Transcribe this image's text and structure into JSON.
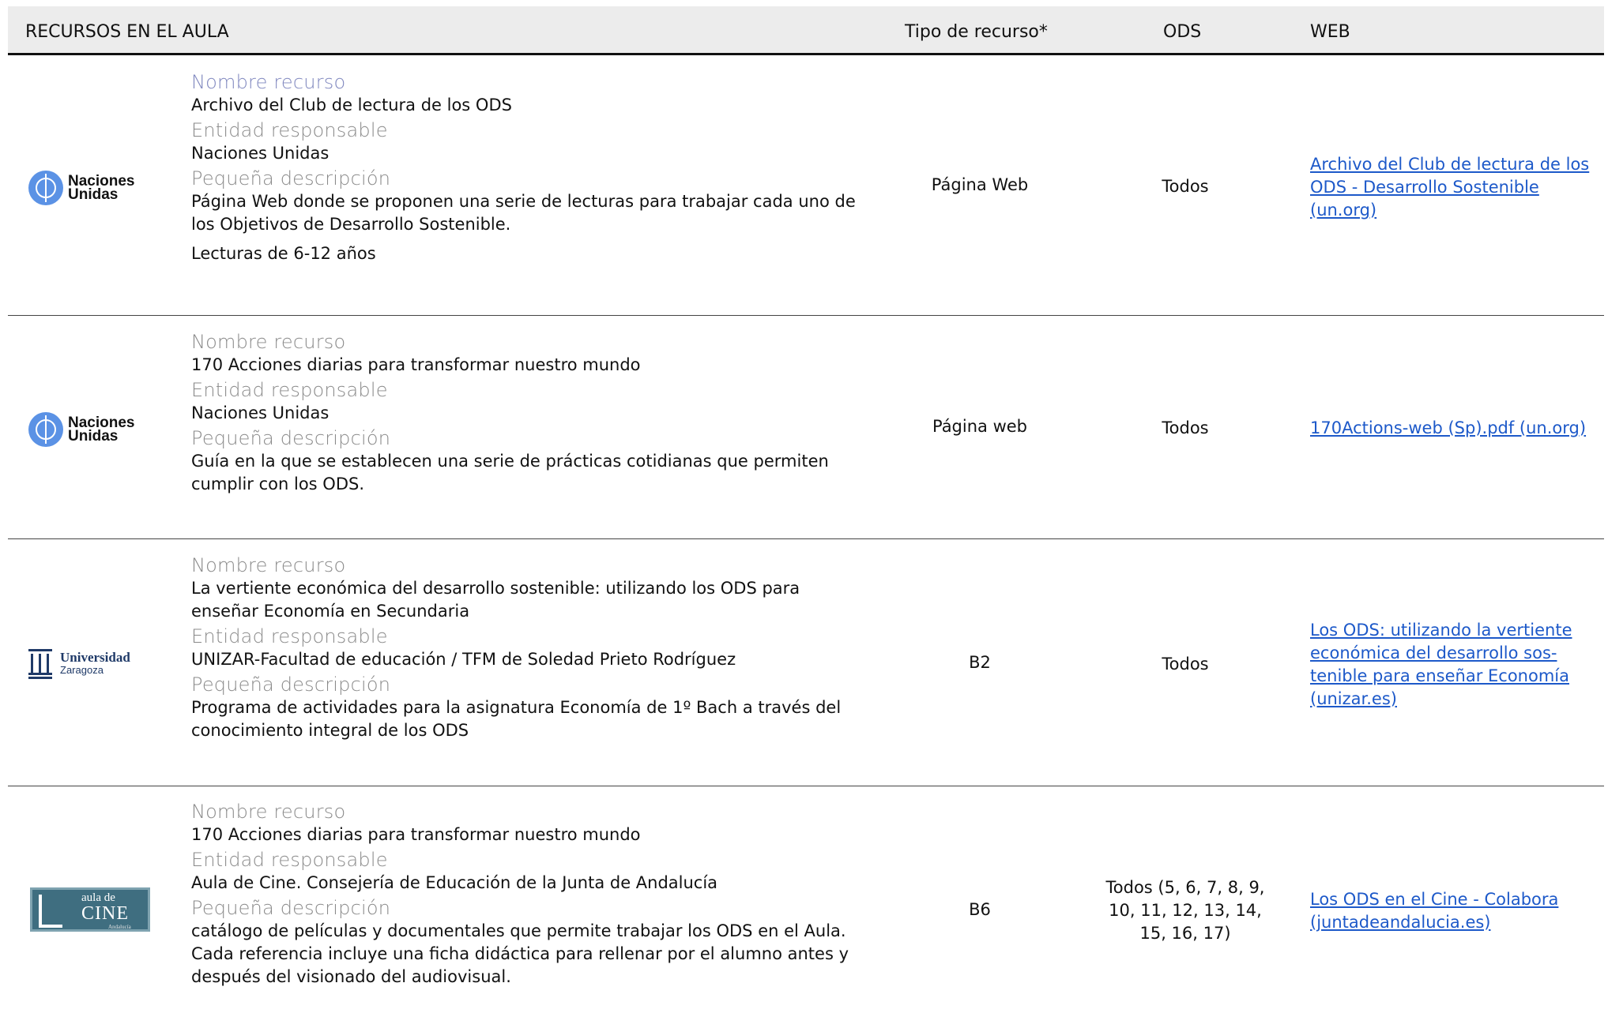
{
  "header": {
    "recursos": "RECURSOS EN EL AULA",
    "tipo": "Tipo de recurso*",
    "ods": "ODS",
    "web": "WEB"
  },
  "labels": {
    "nombre": "Nombre recurso",
    "entidad": "Entidad responsable",
    "descripcion": "Pequeña descripción"
  },
  "rows": [
    {
      "logo": "naciones-unidas",
      "logo_text": [
        "Naciones",
        "Unidas"
      ],
      "nombre": "Archivo del Club de lectura de los ODS",
      "entidad": "Naciones Unidas",
      "descripcion": "Página Web donde se proponen una serie de lecturas para trabajar cada uno de los Objetivos de Desarrollo Sostenible.",
      "extra": "Lecturas de 6-12 años",
      "tipo": "Página Web",
      "ods": "Todos",
      "web": "Archivo del Club de lectura de los ODS - Desarrollo Sostenible (un.org)"
    },
    {
      "logo": "naciones-unidas",
      "logo_text": [
        "Naciones",
        "Unidas"
      ],
      "nombre": "170 Acciones diarias para transformar nuestro mundo",
      "entidad": "Naciones Unidas",
      "descripcion": "Guía en la que se establecen una serie de prácticas cotidianas que permiten cumplir con los ODS.",
      "tipo": "Página web",
      "ods": "Todos",
      "web": "170Actions-web (Sp).pdf (un.org)"
    },
    {
      "logo": "universidad-zaragoza",
      "logo_text": [
        "Universidad",
        "Zaragoza"
      ],
      "nombre": "La vertiente económica del desarrollo sostenible: utilizando los ODS para enseñar Economía en Secundaria",
      "entidad": "UNIZAR-Facultad de educación / TFM de Soledad Prieto Rodríguez",
      "descripcion": "Programa de actividades para la asignatura Economía de 1º Bach a través del conocimiento integral de los ODS",
      "tipo": "B2",
      "ods": "Todos",
      "web": "Los ODS: utilizando la vertiente económica del desarrollo sos-tenible para enseñar Economía (unizar.es)"
    },
    {
      "logo": "aula-de-cine",
      "logo_text": [
        "aula de",
        "CINE",
        "Andalucía"
      ],
      "nombre": "170 Acciones diarias para transformar nuestro mundo",
      "entidad": "Aula de Cine. Consejería de Educación de la Junta de Andalucía",
      "descripcion": "catálogo de películas y documentales que permite trabajar los ODS en el Aula. Cada referencia incluye una ficha didáctica para rellenar por el alumno antes y después del visionado del audiovisual.",
      "tipo": "B6",
      "ods": "Todos (5, 6, 7, 8, 9, 10, 11, 12, 13, 14, 15, 16, 17)",
      "web": "Los ODS en el Cine - Colabora (juntadeandalucia.es)"
    }
  ]
}
